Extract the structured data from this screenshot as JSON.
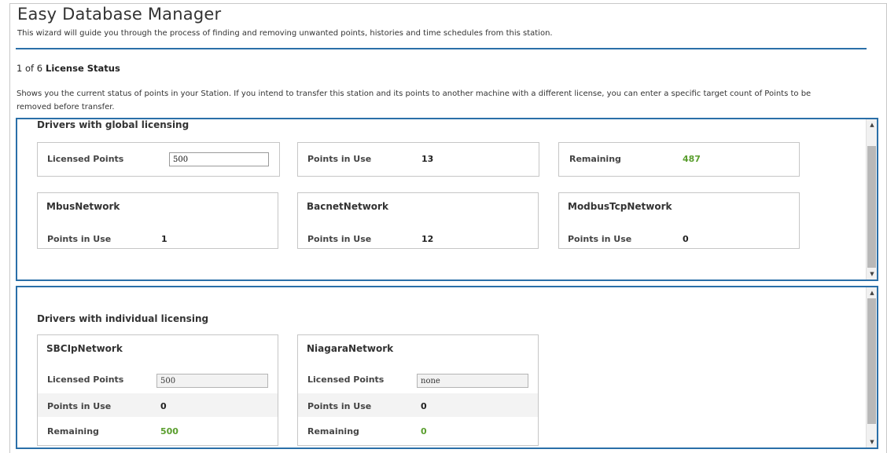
{
  "app": {
    "title": "Easy Database Manager",
    "subtitle": "This wizard will guide you through the process of finding and removing unwanted points, histories and time schedules from this station."
  },
  "step": {
    "counter": "1 of 6",
    "title": "License Status",
    "description": "Shows you the current status of points in your Station. If you intend to transfer this station and its points to another machine with a different license, you can enter a specific target count of Points to be removed before transfer."
  },
  "global": {
    "title": "Drivers with global licensing",
    "licensed_label": "Licensed Points",
    "licensed_value": "500",
    "in_use_label": "Points in Use",
    "in_use_value": "13",
    "remaining_label": "Remaining",
    "remaining_value": "487",
    "networks": [
      {
        "name": "MbusNetwork",
        "in_use_label": "Points in Use",
        "in_use_value": "1"
      },
      {
        "name": "BacnetNetwork",
        "in_use_label": "Points in Use",
        "in_use_value": "12"
      },
      {
        "name": "ModbusTcpNetwork",
        "in_use_label": "Points in Use",
        "in_use_value": "0"
      }
    ]
  },
  "individual": {
    "title": "Drivers with individual licensing",
    "networks": [
      {
        "name": "SBCIpNetwork",
        "licensed_label": "Licensed Points",
        "licensed_value": "500",
        "in_use_label": "Points in Use",
        "in_use_value": "0",
        "remaining_label": "Remaining",
        "remaining_value": "500"
      },
      {
        "name": "NiagaraNetwork",
        "licensed_label": "Licensed Points",
        "licensed_value": "none",
        "in_use_label": "Points in Use",
        "in_use_value": "0",
        "remaining_label": "Remaining",
        "remaining_value": "0"
      }
    ]
  },
  "colors": {
    "accent": "#2a6fa8",
    "positive": "#5a9e2e"
  }
}
